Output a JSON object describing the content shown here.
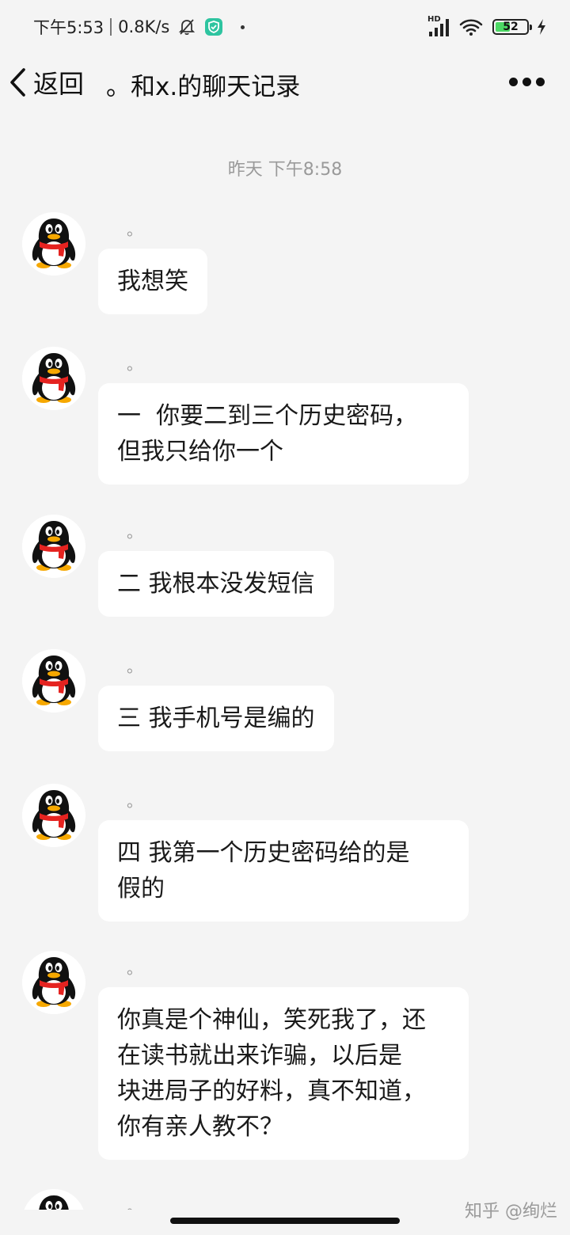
{
  "status_bar": {
    "time": "下午5:53",
    "network_speed": "0.8K/s",
    "signal_label": "HD",
    "battery_level": "52",
    "battery_percent": 52,
    "icons": [
      "mute-bell-icon",
      "shield-app-icon",
      "dot-icon",
      "signal-icon",
      "wifi-icon",
      "battery-icon",
      "charging-icon"
    ]
  },
  "nav": {
    "back_label": "返回",
    "title": "。和x.的聊天记录",
    "icons": [
      "chevron-left-icon",
      "more-icon"
    ]
  },
  "timestamp": "昨天 下午8:58",
  "messages": [
    {
      "sender": "。",
      "text": "我想笑"
    },
    {
      "sender": "。",
      "text": "一  你要二到三个历史密码，\n但我只给你一个"
    },
    {
      "sender": "。",
      "text": "二 我根本没发短信"
    },
    {
      "sender": "。",
      "text": "三 我手机号是编的"
    },
    {
      "sender": "。",
      "text": "四 我第一个历史密码给的是\n假的"
    },
    {
      "sender": "。",
      "text": "你真是个神仙，笑死我了，还\n在读书就出来诈骗，以后是\n块进局子的好料，真不知道，\n你有亲人教不？"
    },
    {
      "sender": "。",
      "text": ""
    }
  ],
  "watermark": "知乎 @绚烂",
  "colors": {
    "background": "#f4f4f4",
    "bubble": "#ffffff",
    "timestamp": "#9a9a9a",
    "battery_fill": "#4cd964",
    "shield_app": "#2ec4a0",
    "penguin_scarf": "#e52320",
    "penguin_beak": "#f6a800"
  }
}
